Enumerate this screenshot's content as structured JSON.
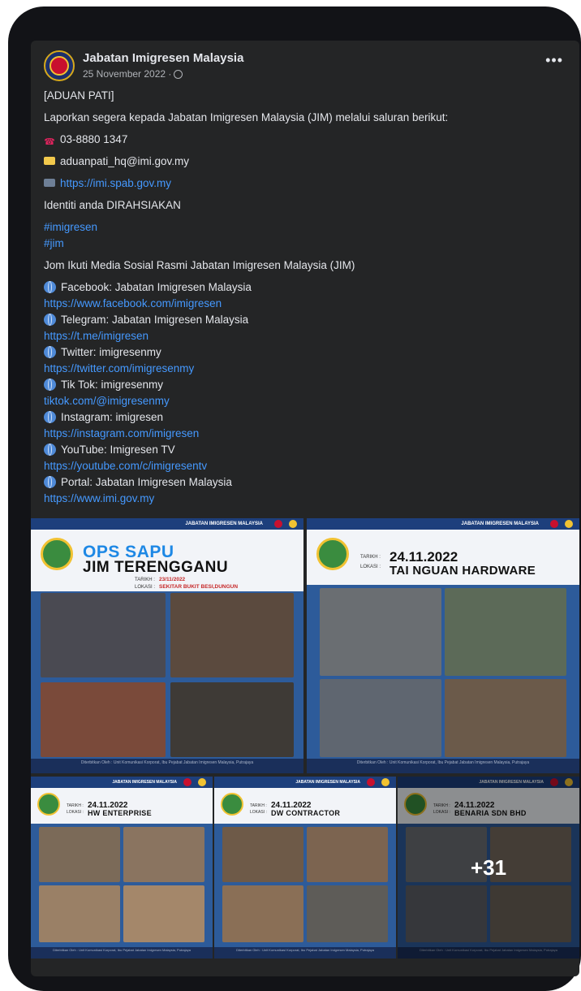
{
  "post": {
    "page_name": "Jabatan Imigresen Malaysia",
    "date": "25 November 2022 ·",
    "more_label": "•••"
  },
  "content": {
    "tag": "[ADUAN PATI]",
    "intro": "Laporkan segera kepada Jabatan Imigresen Malaysia (JIM) melalui saluran berikut:",
    "phone": "03-8880 1347",
    "email": "aduanpati_hq@imi.gov.my",
    "site": "https://imi.spab.gov.my",
    "confidential": "Identiti anda DIRAHSIAKAN",
    "hashtags": [
      "#imigresen",
      "#jim"
    ],
    "follow": "Jom Ikuti Media Sosial Rasmi Jabatan Imigresen Malaysia (JIM)",
    "socials": [
      {
        "label": "Facebook: Jabatan Imigresen Malaysia",
        "url": "https://www.facebook.com/imigresen"
      },
      {
        "label": "Telegram: Jabatan Imigresen Malaysia",
        "url": "https://t.me/imigresen"
      },
      {
        "label": "Twitter: imigresenmy",
        "url": "https://twitter.com/imigresenmy"
      },
      {
        "label": "Tik Tok: imigresenmy",
        "url": "tiktok.com/@imigresenmy"
      },
      {
        "label": "Instagram: imigresen",
        "url": "https://instagram.com/imigresen"
      },
      {
        "label": "YouTube: Imigresen TV",
        "url": "https://youtube.com/c/imigresentv"
      },
      {
        "label": "Portal: Jabatan Imigresen Malaysia",
        "url": "https://www.imi.gov.my"
      }
    ]
  },
  "gallery": {
    "banner": "JABATAN IMIGRESEN MALAYSIA",
    "footer": "Diterbitkan Oleh : Unit Komunikasi Korporat, Ibu Pejabat Jabatan Imigresen Malaysia, Putrajaya",
    "tarikh_label": "TARIKH :",
    "lokasi_label": "LOKASI :",
    "tile1": {
      "title1": "OPS SAPU",
      "title2": "JIM TERENGGANU",
      "tarikh": "23/11/2022",
      "lokasi": "SEKITAR BUKIT BESI,DUNGUN"
    },
    "tile2": {
      "date": "24.11.2022",
      "company": "TAI NGUAN HARDWARE"
    },
    "tile3": {
      "date": "24.11.2022",
      "company": "HW ENTERPRISE"
    },
    "tile4": {
      "date": "24.11.2022",
      "company": "DW CONTRACTOR"
    },
    "tile5": {
      "date": "24.11.2022",
      "company": "BENARIA SDN BHD"
    },
    "more_count": "+31"
  },
  "colors": {
    "card_bg": "#242526",
    "text": "#e4e6eb",
    "link": "#4599ff",
    "muted": "#b0b3b8"
  }
}
